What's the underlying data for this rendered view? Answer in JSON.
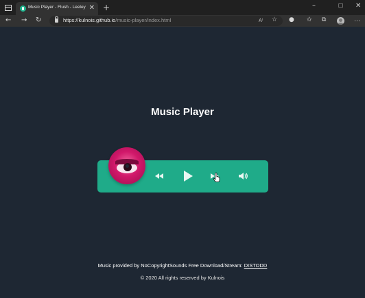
{
  "browser": {
    "tab_title": "Music Player - Flush - Leeley",
    "tab_close": "✕",
    "new_tab": "+",
    "window_controls": {
      "minimize": "–",
      "maximize": "☐",
      "close": "✕"
    },
    "url_host": "https://kulnois.github.io",
    "url_path": "/music-player/index.html",
    "icons": [
      "back-icon",
      "forward-icon",
      "refresh-icon",
      "lock-icon",
      "read-aloud-icon",
      "favorite-icon",
      "extension-icon",
      "favorites-bar-icon",
      "collections-icon",
      "profile-avatar"
    ]
  },
  "page": {
    "title": "Music Player",
    "player": {
      "cover_icon": "album-cover-image",
      "prev_icon": "backward-icon",
      "play_icon": "play-icon",
      "next_icon": "forward-icon",
      "volume_icon": "volume-icon",
      "accent_color": "#1fab89",
      "background_color": "#1e2733"
    },
    "footer": {
      "credit_text": "Music provided by NoCopyrightSounds Free Download/Stream: ",
      "credit_link": "DISTODD",
      "copyright": "© 2020 All rights reserved by Kulnois"
    }
  }
}
